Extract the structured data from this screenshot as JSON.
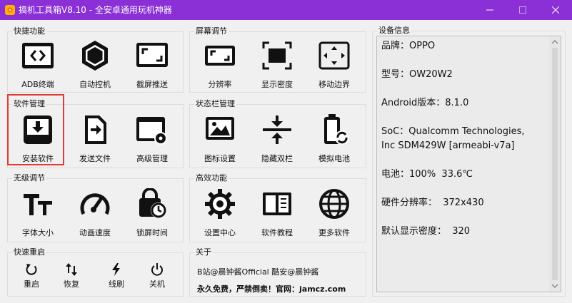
{
  "window": {
    "title": "搞机工具箱V8.10 - 全安卓通用玩机神器",
    "accent": "#8b2fd6"
  },
  "groups": {
    "quick": {
      "title": "快捷功能",
      "items": [
        {
          "label": "ADB终端",
          "icon": "terminal-icon"
        },
        {
          "label": "自动控机",
          "icon": "hexagon-icon"
        },
        {
          "label": "截屏推送",
          "icon": "screenshot-icon"
        }
      ]
    },
    "screen": {
      "title": "屏幕调节",
      "items": [
        {
          "label": "分辨率",
          "icon": "resolution-icon"
        },
        {
          "label": "显示密度",
          "icon": "density-icon"
        },
        {
          "label": "移动边界",
          "icon": "move-border-icon"
        }
      ]
    },
    "software": {
      "title": "软件管理",
      "items": [
        {
          "label": "安装软件",
          "icon": "install-icon"
        },
        {
          "label": "发送文件",
          "icon": "send-file-icon"
        },
        {
          "label": "高级管理",
          "icon": "advanced-manage-icon"
        }
      ]
    },
    "statusbar": {
      "title": "状态栏管理",
      "items": [
        {
          "label": "图标设置",
          "icon": "image-icon"
        },
        {
          "label": "隐藏双栏",
          "icon": "hide-bars-icon"
        },
        {
          "label": "模拟电池",
          "icon": "battery-icon"
        }
      ]
    },
    "accessibility": {
      "title": "无级调节",
      "items": [
        {
          "label": "字体大小",
          "icon": "font-size-icon"
        },
        {
          "label": "动画速度",
          "icon": "speedometer-icon"
        },
        {
          "label": "锁屏时间",
          "icon": "lock-clock-icon"
        }
      ]
    },
    "efficiency": {
      "title": "高效功能",
      "items": [
        {
          "label": "设置中心",
          "icon": "gear-icon"
        },
        {
          "label": "软件教程",
          "icon": "book-icon"
        },
        {
          "label": "更多软件",
          "icon": "globe-icon"
        }
      ]
    },
    "reboot": {
      "title": "快速重启",
      "items": [
        {
          "label": "重启",
          "icon": "restart-icon"
        },
        {
          "label": "恢复",
          "icon": "recovery-icon"
        },
        {
          "label": "线刷",
          "icon": "flash-icon"
        },
        {
          "label": "关机",
          "icon": "power-icon"
        }
      ]
    },
    "about": {
      "title": "关于",
      "line1": "B站@晨钟酱Official   酷安@晨钟酱",
      "line2": "永久免费，严禁倒卖！官网：jamcz.com"
    }
  },
  "device_info": {
    "title": "设备信息",
    "text": "品牌：OPPO\n\n型号：OW20W2\n\nAndroid版本：8.1.0\n\nSoC：Qualcomm Technologies,\nInc SDM429W [armeabi-v7a]\n\n电池：100%  33.6℃\n\n硬件分辨率：  372x430\n\n默认显示密度：  320"
  }
}
